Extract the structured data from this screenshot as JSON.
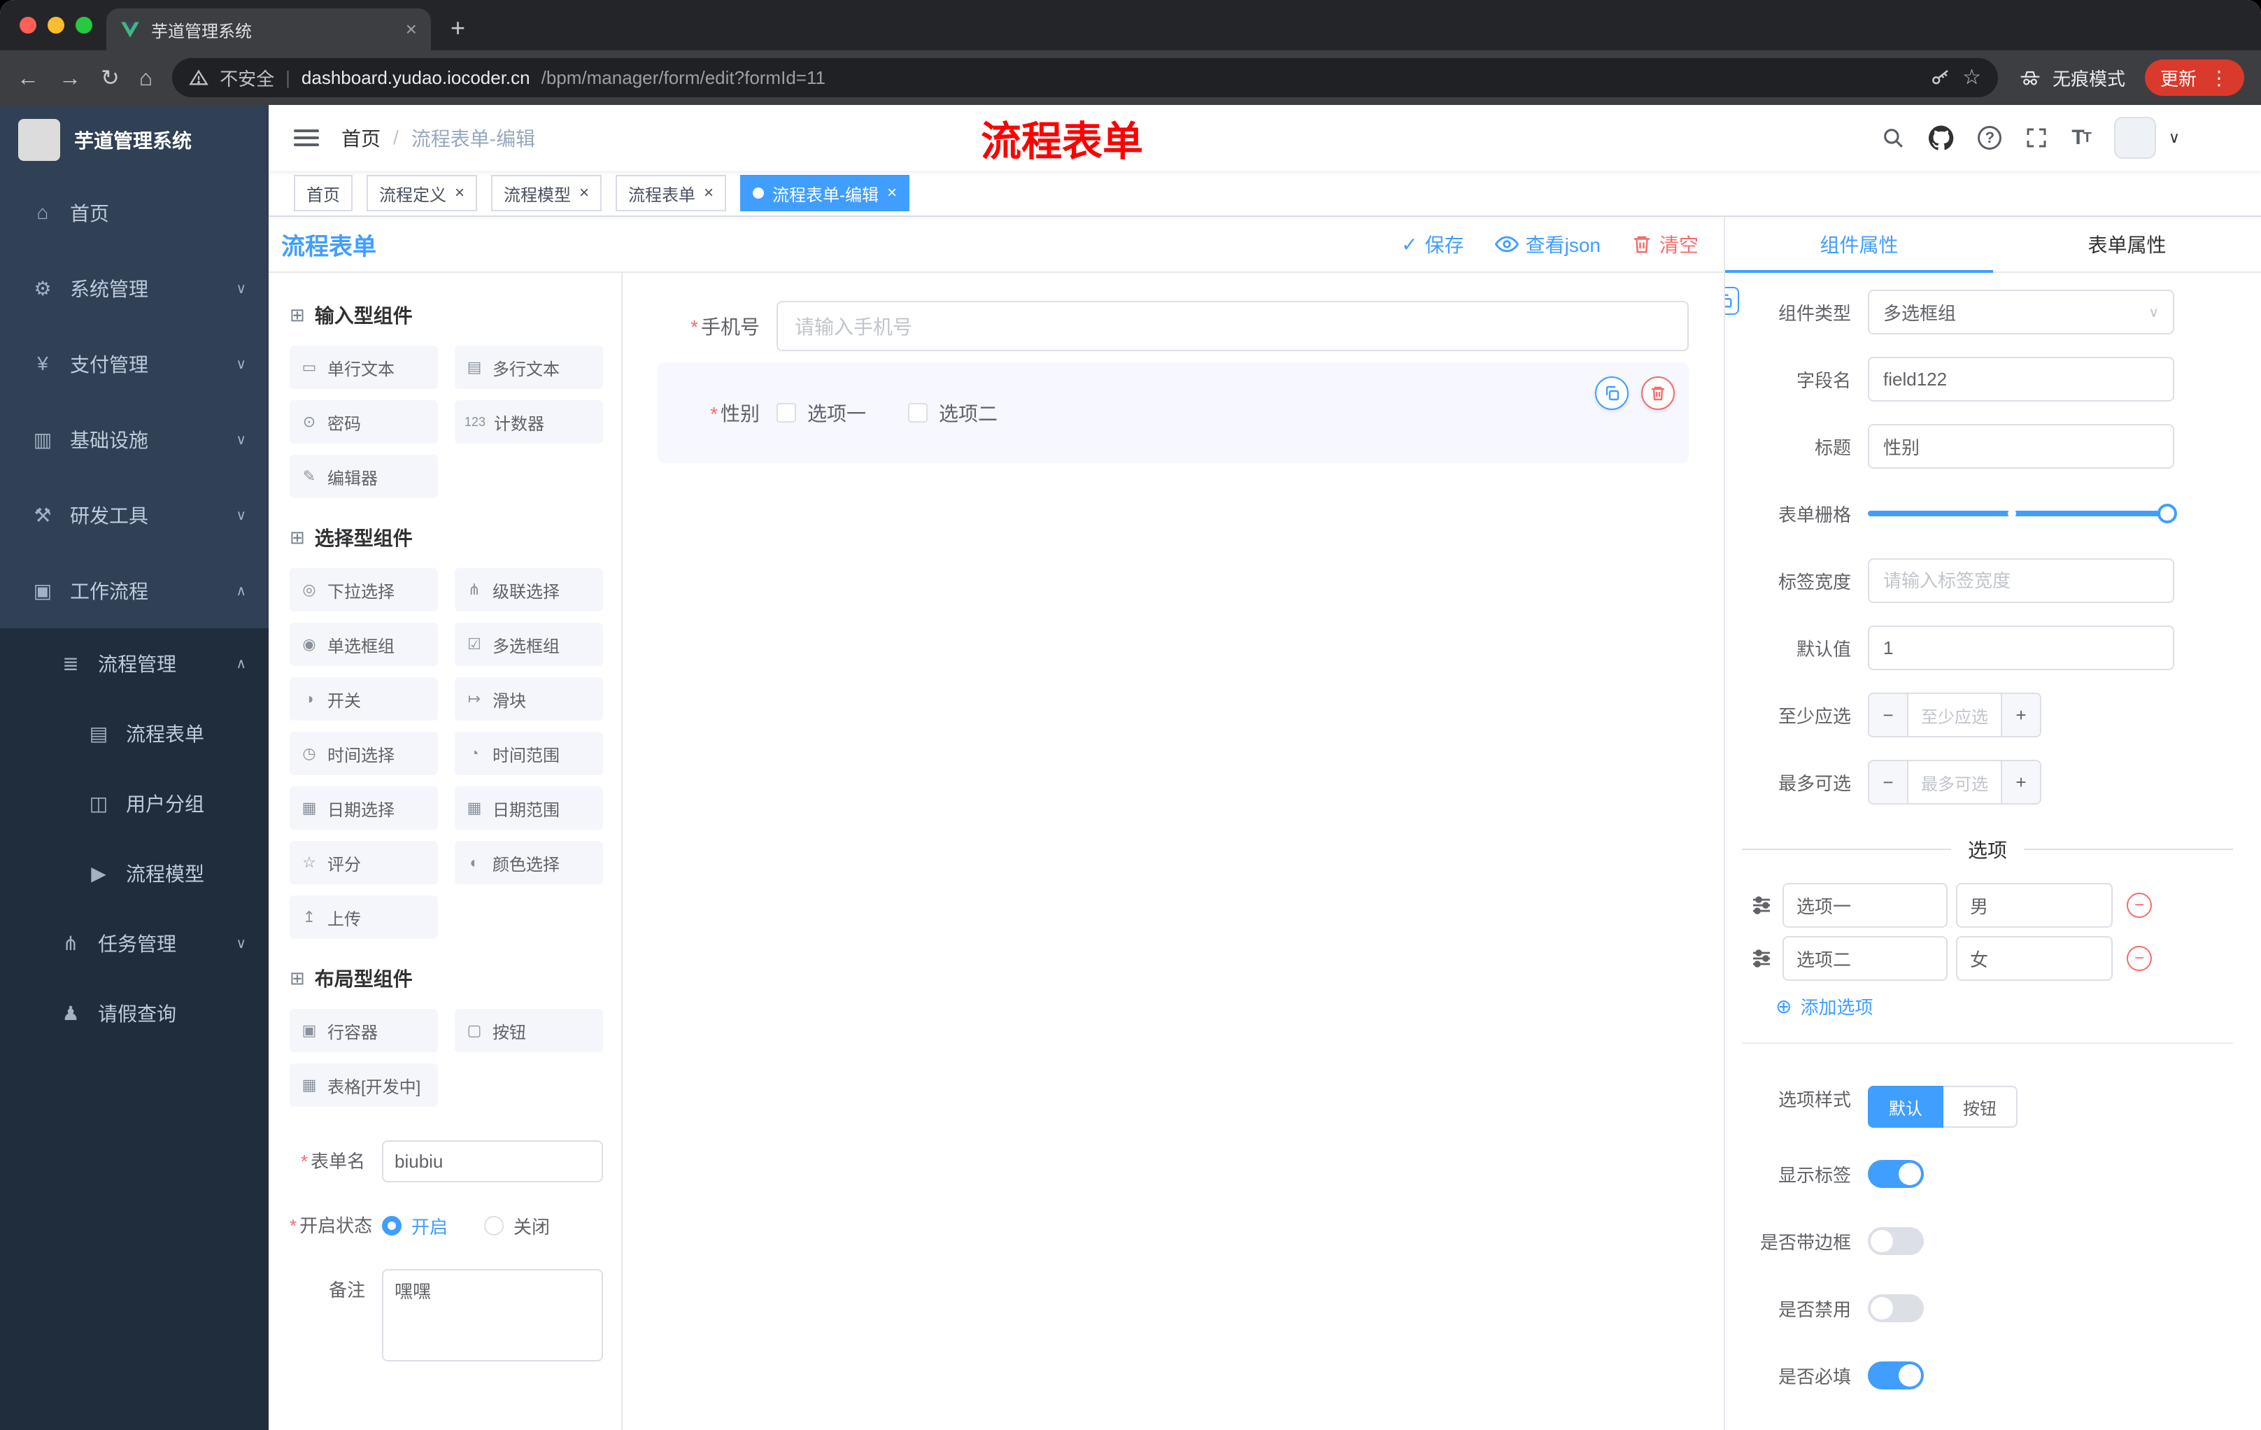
{
  "colors": {
    "accent": "#409EFF",
    "danger": "#F56C6C",
    "annotation": "#FF0000",
    "sidebar": "#304156",
    "sidebar_dark": "#1F2D3D"
  },
  "icons": {
    "close": "×",
    "plus": "+",
    "back": "←",
    "forward": "→",
    "reload": "↻",
    "home_nav": "⌂",
    "dots": "⋮",
    "star": "☆",
    "caret_down": "∨",
    "caret_up": "∧",
    "check": "✓",
    "minus": "−",
    "add_circle": "⊕",
    "asterisk": "*",
    "section": "⊞",
    "menu_home": "⌂",
    "menu_system": "⚙",
    "menu_pay": "¥",
    "menu_infra": "▥",
    "menu_devtools": "⚒",
    "menu_workflow": "▣",
    "menu_process": "≣",
    "menu_form": "▤",
    "menu_usergroup": "◫",
    "menu_model": "▶",
    "menu_task": "⋔",
    "menu_leave": "♟"
  },
  "browser": {
    "tab_title": "芋道管理系统",
    "security_label": "不安全",
    "url_domain": "dashboard.yudao.iocoder.cn",
    "url_path": "/bpm/manager/form/edit?formId=11",
    "incognito_label": "无痕模式",
    "update_label": "更新"
  },
  "sidebar": {
    "logo_title": "芋道管理系统",
    "items": [
      {
        "label": "首页"
      },
      {
        "label": "系统管理"
      },
      {
        "label": "支付管理"
      },
      {
        "label": "基础设施"
      },
      {
        "label": "研发工具"
      },
      {
        "label": "工作流程"
      },
      {
        "label": "流程管理"
      },
      {
        "label": "流程表单"
      },
      {
        "label": "用户分组"
      },
      {
        "label": "流程模型"
      },
      {
        "label": "任务管理"
      },
      {
        "label": "请假查询"
      }
    ]
  },
  "header": {
    "breadcrumb_home": "首页",
    "breadcrumb_sep": "/",
    "breadcrumb_current": "流程表单-编辑",
    "annotation": "流程表单"
  },
  "tags": [
    {
      "label": "首页"
    },
    {
      "label": "流程定义"
    },
    {
      "label": "流程模型"
    },
    {
      "label": "流程表单"
    },
    {
      "label": "流程表单-编辑"
    }
  ],
  "designer": {
    "title": "流程表单",
    "toolbar": {
      "save": "保存",
      "view_json": "查看json",
      "clear": "清空"
    },
    "palette": {
      "sections": [
        {
          "title": "输入型组件",
          "items": [
            {
              "label": "单行文本",
              "icon": "▭"
            },
            {
              "label": "多行文本",
              "icon": "▤"
            },
            {
              "label": "密码",
              "icon": "⊙"
            },
            {
              "label": "计数器",
              "icon": "123"
            },
            {
              "label": "编辑器",
              "icon": "✎"
            }
          ]
        },
        {
          "title": "选择型组件",
          "items": [
            {
              "label": "下拉选择",
              "icon": "◎"
            },
            {
              "label": "级联选择",
              "icon": "⋔"
            },
            {
              "label": "单选框组",
              "icon": "◉"
            },
            {
              "label": "多选框组",
              "icon": "☑"
            },
            {
              "label": "开关",
              "icon": "◑"
            },
            {
              "label": "滑块",
              "icon": "↦"
            },
            {
              "label": "时间选择",
              "icon": "◷"
            },
            {
              "label": "时间范围",
              "icon": "◔"
            },
            {
              "label": "日期选择",
              "icon": "▦"
            },
            {
              "label": "日期范围",
              "icon": "▦"
            },
            {
              "label": "评分",
              "icon": "☆"
            },
            {
              "label": "颜色选择",
              "icon": "◐"
            },
            {
              "label": "上传",
              "icon": "↥"
            }
          ]
        },
        {
          "title": "布局型组件",
          "items": [
            {
              "label": "行容器",
              "icon": "▣"
            },
            {
              "label": "按钮",
              "icon": "▢"
            },
            {
              "label": "表格[开发中]",
              "icon": "▦"
            }
          ]
        }
      ],
      "form": {
        "name_label": "表单名",
        "name_value": "biubiu",
        "status_label": "开启状态",
        "status_on": "开启",
        "status_off": "关闭",
        "remark_label": "备注",
        "remark_value": "嘿嘿"
      }
    },
    "canvas": {
      "phone_label": "手机号",
      "phone_placeholder": "请输入手机号",
      "gender_label": "性别",
      "gender_opt1": "选项一",
      "gender_opt2": "选项二"
    },
    "props": {
      "tab_component": "组件属性",
      "tab_form": "表单属性",
      "component_type_label": "组件类型",
      "component_type_value": "多选框组",
      "field_name_label": "字段名",
      "field_name_value": "field122",
      "title_label": "标题",
      "title_value": "性别",
      "grid_label": "表单栅格",
      "label_width_label": "标签宽度",
      "label_width_placeholder": "请输入标签宽度",
      "default_label": "默认值",
      "default_value": "1",
      "min_label": "至少应选",
      "min_placeholder": "至少应选",
      "max_label": "最多可选",
      "max_placeholder": "最多可选",
      "options_title": "选项",
      "options": [
        {
          "name": "选项一",
          "value": "男"
        },
        {
          "name": "选项二",
          "value": "女"
        }
      ],
      "add_option": "添加选项",
      "style_label": "选项样式",
      "style_default": "默认",
      "style_button": "按钮",
      "switch_show_label": "显示标签",
      "switch_border": "是否带边框",
      "switch_disabled": "是否禁用",
      "switch_required": "是否必填"
    }
  }
}
